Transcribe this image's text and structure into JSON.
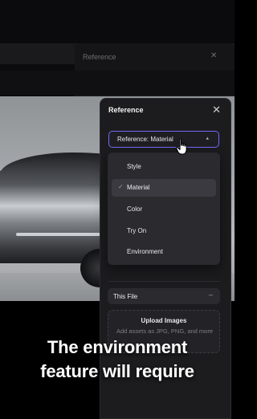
{
  "background": {
    "ghost_panel_title": "Reference"
  },
  "panel": {
    "title": "Reference",
    "close_icon": "close-icon",
    "reference_select": {
      "label": "Reference: Material",
      "caret": "▴"
    },
    "menu": {
      "items": [
        {
          "label": "Style",
          "selected": false
        },
        {
          "label": "Material",
          "selected": true
        },
        {
          "label": "Color",
          "selected": false
        },
        {
          "label": "Try On",
          "selected": false
        },
        {
          "label": "Environment",
          "selected": false
        }
      ]
    },
    "file_select": {
      "label": "This File",
      "caret": "–"
    },
    "upload": {
      "title": "Upload Images",
      "subtitle": "Add assets as JPG, PNG, and more"
    }
  },
  "captions": {
    "line1": "The environment",
    "line2": "feature will require"
  },
  "colors": {
    "accent": "#6f6af6",
    "panel_bg": "#1c1c1f",
    "menu_bg": "#2a2a2f"
  }
}
